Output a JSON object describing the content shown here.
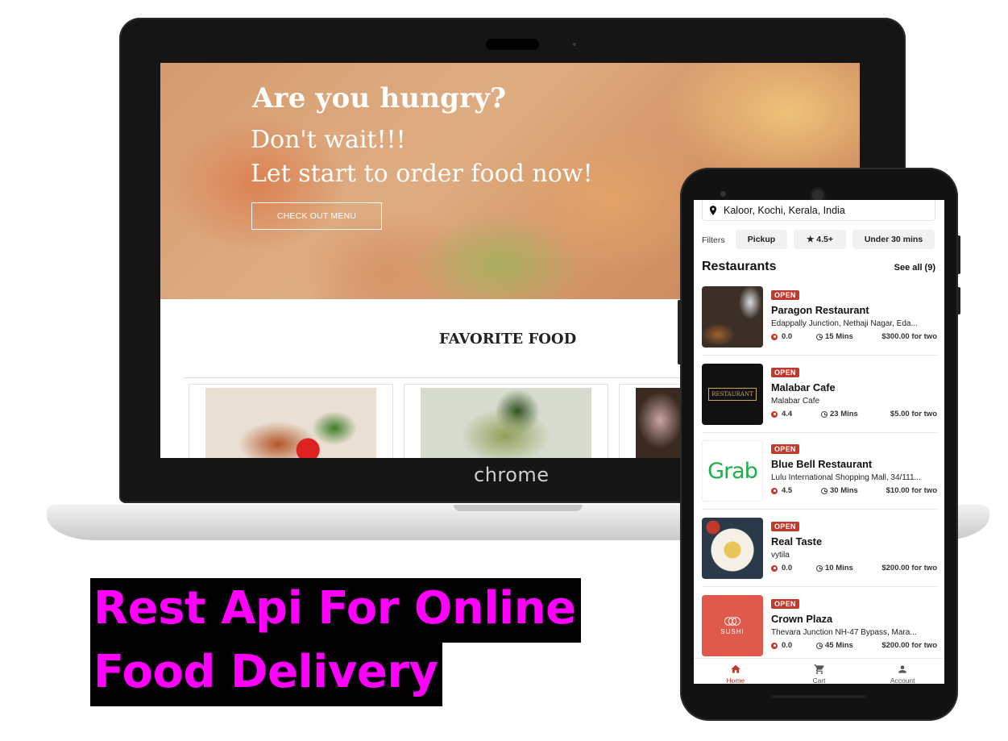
{
  "laptop": {
    "hero": {
      "title": "Are you hungry?",
      "subtitle_line1": "Don't wait!!!",
      "subtitle_line2": "Let start to order food now!",
      "cta_label": "CHECK OUT MENU"
    },
    "section_title": "FAVORITE FOOD",
    "brand_label": "chrome"
  },
  "headline": {
    "line1": "Rest Api For Online",
    "line2": "Food Delivery",
    "text_color": "#ff00ff",
    "background_color": "#000000"
  },
  "phone": {
    "location": "Kaloor, Kochi, Kerala, India",
    "filters_label": "Filters",
    "chips": [
      "Pickup",
      "★ 4.5+",
      "Under 30 mins"
    ],
    "section_title": "Restaurants",
    "see_all": "See all (9)",
    "restaurants": [
      {
        "status": "OPEN",
        "name": "Paragon Restaurant",
        "address": "Edappally Junction, Nethaji Nagar, Eda...",
        "rating": "0.0",
        "time": "15 Mins",
        "price": "$300.00 for two"
      },
      {
        "status": "OPEN",
        "name": "Malabar Cafe",
        "address": "Malabar Cafe",
        "rating": "4.4",
        "time": "23 Mins",
        "price": "$5.00 for two",
        "logo_text": "RESTAURANT"
      },
      {
        "status": "OPEN",
        "name": "Blue Bell Restaurant",
        "address": "Lulu International Shopping Mall, 34/111...",
        "rating": "4.5",
        "time": "30 Mins",
        "price": "$10.00 for two",
        "logo_text": "Grab"
      },
      {
        "status": "OPEN",
        "name": "Real Taste",
        "address": "vytila",
        "rating": "0.0",
        "time": "10 Mins",
        "price": "$200.00 for two"
      },
      {
        "status": "OPEN",
        "name": "Crown Plaza",
        "address": "Thevara Junction NH-47 Bypass, Mara...",
        "rating": "0.0",
        "time": "45 Mins",
        "price": "$200.00 for two",
        "logo_text": "SUSHI"
      }
    ],
    "nav": [
      "Home",
      "Cart",
      "Account"
    ],
    "accent_color": "#c0392b"
  }
}
